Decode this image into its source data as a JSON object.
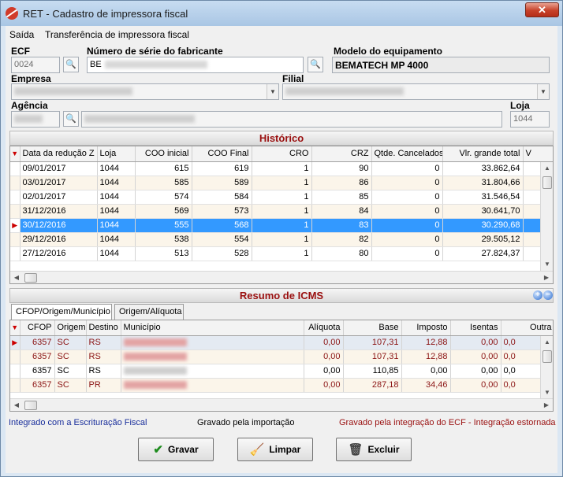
{
  "window": {
    "title": "RET - Cadastro de impressora fiscal",
    "close_label": "✕"
  },
  "menu": [
    "Saída",
    "Transferência de impressora fiscal"
  ],
  "form": {
    "ecf_label": "ECF",
    "ecf_value": "0024",
    "serial_label": "Número de série do fabricante",
    "serial_value": "BE",
    "modelo_label": "Modelo do equipamento",
    "modelo_value": "BEMATECH MP 4000",
    "empresa_label": "Empresa",
    "filial_label": "Filial",
    "agencia_label": "Agência",
    "loja_label": "Loja",
    "loja_value": "1044"
  },
  "historico": {
    "title": "Histórico",
    "columns": [
      "Data da redução Z",
      "Loja",
      "COO inicial",
      "COO Final",
      "CRO",
      "CRZ",
      "Qtde. Cancelados",
      "Vlr. grande total",
      "V"
    ],
    "rows": [
      [
        "09/01/2017",
        "1044",
        "615",
        "619",
        "1",
        "90",
        "0",
        "33.862,64"
      ],
      [
        "03/01/2017",
        "1044",
        "585",
        "589",
        "1",
        "86",
        "0",
        "31.804,66"
      ],
      [
        "02/01/2017",
        "1044",
        "574",
        "584",
        "1",
        "85",
        "0",
        "31.546,54"
      ],
      [
        "31/12/2016",
        "1044",
        "569",
        "573",
        "1",
        "84",
        "0",
        "30.641,70"
      ],
      [
        "30/12/2016",
        "1044",
        "555",
        "568",
        "1",
        "83",
        "0",
        "30.290,68"
      ],
      [
        "29/12/2016",
        "1044",
        "538",
        "554",
        "1",
        "82",
        "0",
        "29.505,12"
      ],
      [
        "27/12/2016",
        "1044",
        "513",
        "528",
        "1",
        "80",
        "0",
        "27.824,37"
      ]
    ]
  },
  "icms": {
    "title": "Resumo de ICMS",
    "tabs": [
      "CFOP/Origem/Município",
      "Origem/Alíquota"
    ],
    "columns": [
      "CFOP",
      "Origem",
      "Destino",
      "Município",
      "Alíquota",
      "Base",
      "Imposto",
      "Isentas",
      "Outra"
    ],
    "rows": [
      [
        "6357",
        "SC",
        "RS",
        "0,00",
        "107,31",
        "12,88",
        "0,00",
        "0,0"
      ],
      [
        "6357",
        "SC",
        "RS",
        "0,00",
        "107,31",
        "12,88",
        "0,00",
        "0,0"
      ],
      [
        "6357",
        "SC",
        "RS",
        "0,00",
        "110,85",
        "0,00",
        "0,00",
        "0,0"
      ],
      [
        "6357",
        "SC",
        "PR",
        "0,00",
        "287,18",
        "34,46",
        "0,00",
        "0,0"
      ]
    ]
  },
  "status": {
    "integrado": "Integrado com a Escrituração Fiscal",
    "gravado": "Gravado pela importação",
    "estornada": "Gravado pela integração do ECF - Integração estornada"
  },
  "buttons": {
    "gravar": "Gravar",
    "limpar": "Limpar",
    "excluir": "Excluir"
  },
  "colors": {
    "status_blue": "#1a2f9c",
    "status_red": "#9a1010",
    "selection": "#3399ff",
    "section_title": "#9a1010"
  }
}
